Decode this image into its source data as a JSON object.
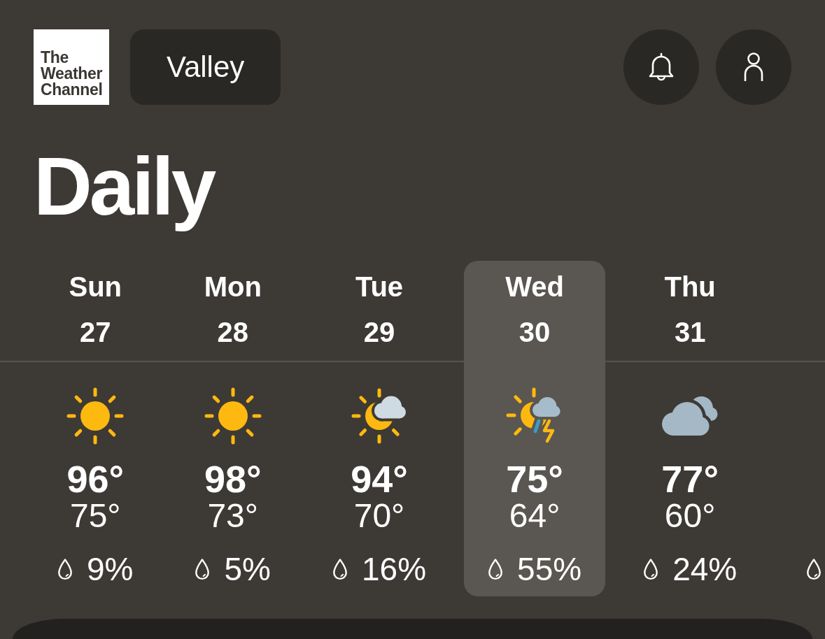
{
  "header": {
    "logo": {
      "text": "The Weather Channel"
    },
    "location": {
      "label": "Valley"
    }
  },
  "title": "Daily",
  "days": [
    {
      "day": "Sun",
      "date": "27",
      "kind": "sun",
      "high": "96°",
      "low": "75°",
      "precip": "9%",
      "selected": false
    },
    {
      "day": "Mon",
      "date": "28",
      "kind": "sun",
      "high": "98°",
      "low": "73°",
      "precip": "5%",
      "selected": false
    },
    {
      "day": "Tue",
      "date": "29",
      "kind": "sun-cloud",
      "high": "94°",
      "low": "70°",
      "precip": "16%",
      "selected": false
    },
    {
      "day": "Wed",
      "date": "30",
      "kind": "sun-storm",
      "high": "75°",
      "low": "64°",
      "precip": "55%",
      "selected": true
    },
    {
      "day": "Thu",
      "date": "31",
      "kind": "clouds",
      "high": "77°",
      "low": "60°",
      "precip": "24%",
      "selected": false
    }
  ]
}
